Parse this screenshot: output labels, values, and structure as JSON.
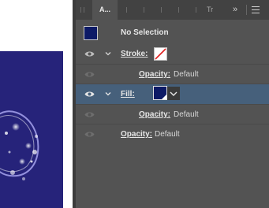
{
  "tabs": {
    "active": "A...",
    "inactive": "Tr",
    "more": "»"
  },
  "selection": {
    "label": "No Selection",
    "swatch_color": "#0d1a66"
  },
  "stroke": {
    "label": "Stroke:",
    "opacity_label": "Opacity:",
    "opacity_value": "Default"
  },
  "fill": {
    "label": "Fill:",
    "swatch_color": "#0d1a66",
    "opacity_label": "Opacity:",
    "opacity_value": "Default"
  },
  "object_opacity": {
    "label": "Opacity:",
    "value": "Default"
  },
  "colors": {
    "panel_bg": "#535353",
    "selected_row": "#46607b",
    "art_bg": "#26237a"
  }
}
